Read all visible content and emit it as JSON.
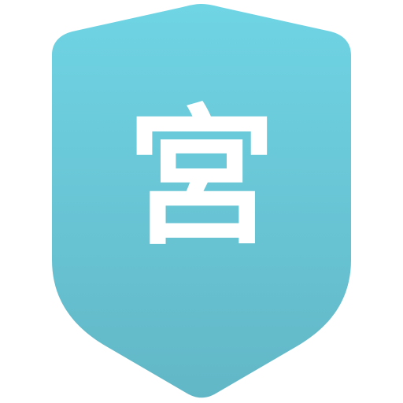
{
  "badge": {
    "glyph": "宮",
    "gradient_top": "#6fd4e4",
    "gradient_bottom": "#62b7c6",
    "glyph_color": "#ffffff"
  },
  "icons": {
    "shield": "shield-icon"
  }
}
